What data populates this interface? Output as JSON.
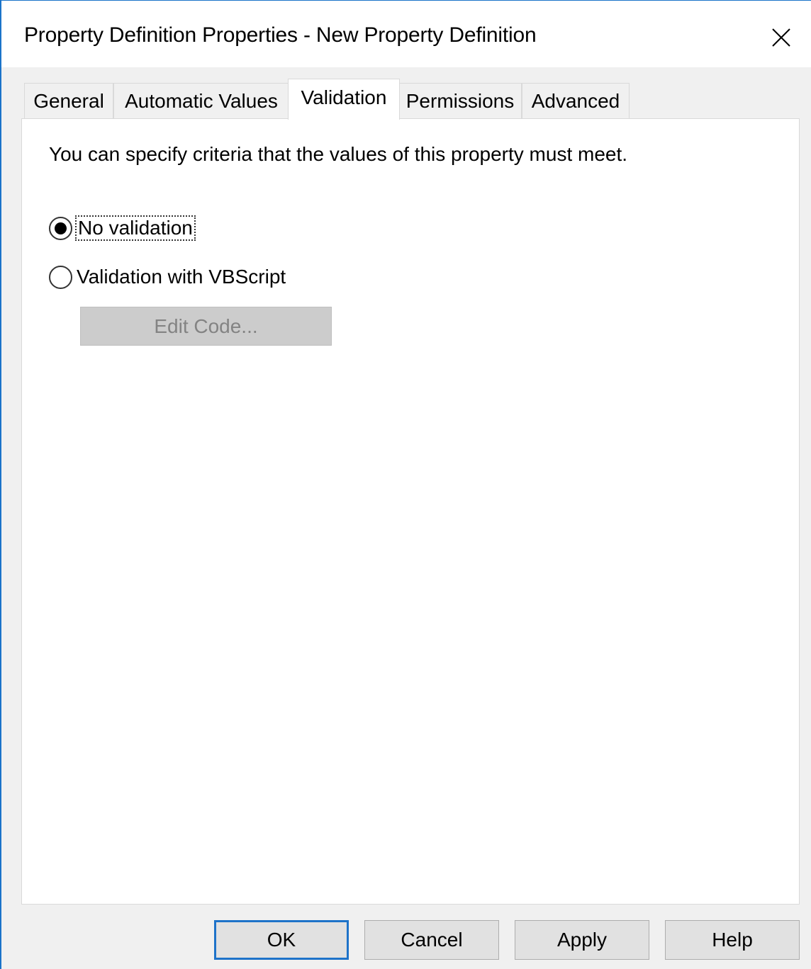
{
  "window": {
    "title": "Property Definition Properties - New Property Definition",
    "close_glyph": "✕",
    "close_icon": "close-icon"
  },
  "tabs": [
    {
      "label": "General",
      "active": false
    },
    {
      "label": "Automatic Values",
      "active": false
    },
    {
      "label": "Validation",
      "active": true
    },
    {
      "label": "Permissions",
      "active": false
    },
    {
      "label": "Advanced",
      "active": false
    }
  ],
  "validation": {
    "intro": "You can specify criteria that the values of this property must meet.",
    "options": [
      {
        "label": "No validation",
        "checked": true,
        "access_key": "N"
      },
      {
        "label": "Validation with VBScript",
        "checked": false,
        "access_key": "V"
      }
    ],
    "edit_code_label": "Edit Code...",
    "edit_code_enabled": false
  },
  "footer": {
    "ok_label": "OK",
    "cancel_label": "Cancel",
    "apply_label": "Apply",
    "help_label": "Help"
  },
  "colors": {
    "accent": "#1e73c9",
    "dialog_bg": "#f0f0f0",
    "panel_bg": "#ffffff",
    "disabled_text": "#838383"
  }
}
